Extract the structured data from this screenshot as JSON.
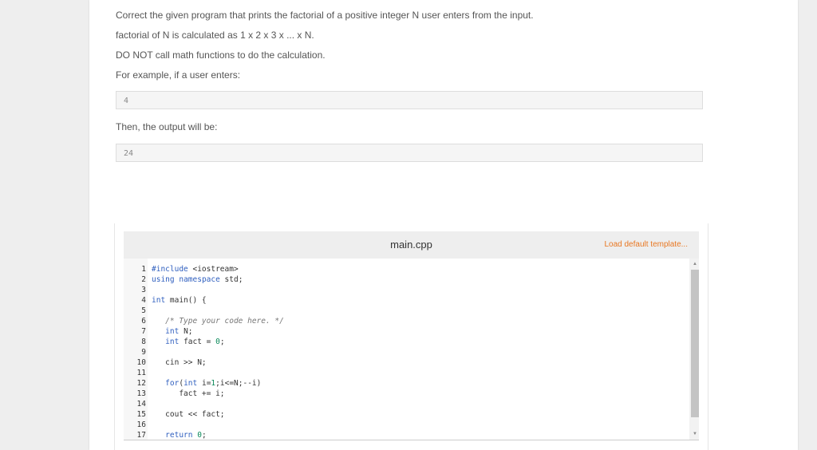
{
  "problem": {
    "line1": "Correct the given program that prints the factorial of a positive integer N user enters from the input.",
    "line2": "factorial of N is calculated as 1 x 2 x 3 x ... x N.",
    "line3": "DO NOT call math functions to do the calculation.",
    "line4": "For example, if a user enters:",
    "input_example": "4",
    "then_text": "Then, the output will be:",
    "output_example": "24"
  },
  "editor": {
    "filename": "main.cpp",
    "load_template_label": "Load default template...",
    "lines": [
      {
        "n": "1",
        "code": "#include <iostream>"
      },
      {
        "n": "2",
        "code": "using namespace std;"
      },
      {
        "n": "3",
        "code": ""
      },
      {
        "n": "4",
        "code": "int main() {"
      },
      {
        "n": "5",
        "code": ""
      },
      {
        "n": "6",
        "code": "   /* Type your code here. */"
      },
      {
        "n": "7",
        "code": "   int N;"
      },
      {
        "n": "8",
        "code": "   int fact = 0;"
      },
      {
        "n": "9",
        "code": ""
      },
      {
        "n": "10",
        "code": "   cin >> N;"
      },
      {
        "n": "11",
        "code": ""
      },
      {
        "n": "12",
        "code": "   for(int i=1;i<=N;--i)"
      },
      {
        "n": "13",
        "code": "      fact += i;"
      },
      {
        "n": "14",
        "code": ""
      },
      {
        "n": "15",
        "code": "   cout << fact;"
      },
      {
        "n": "16",
        "code": ""
      },
      {
        "n": "17",
        "code": "   return 0;"
      }
    ]
  }
}
